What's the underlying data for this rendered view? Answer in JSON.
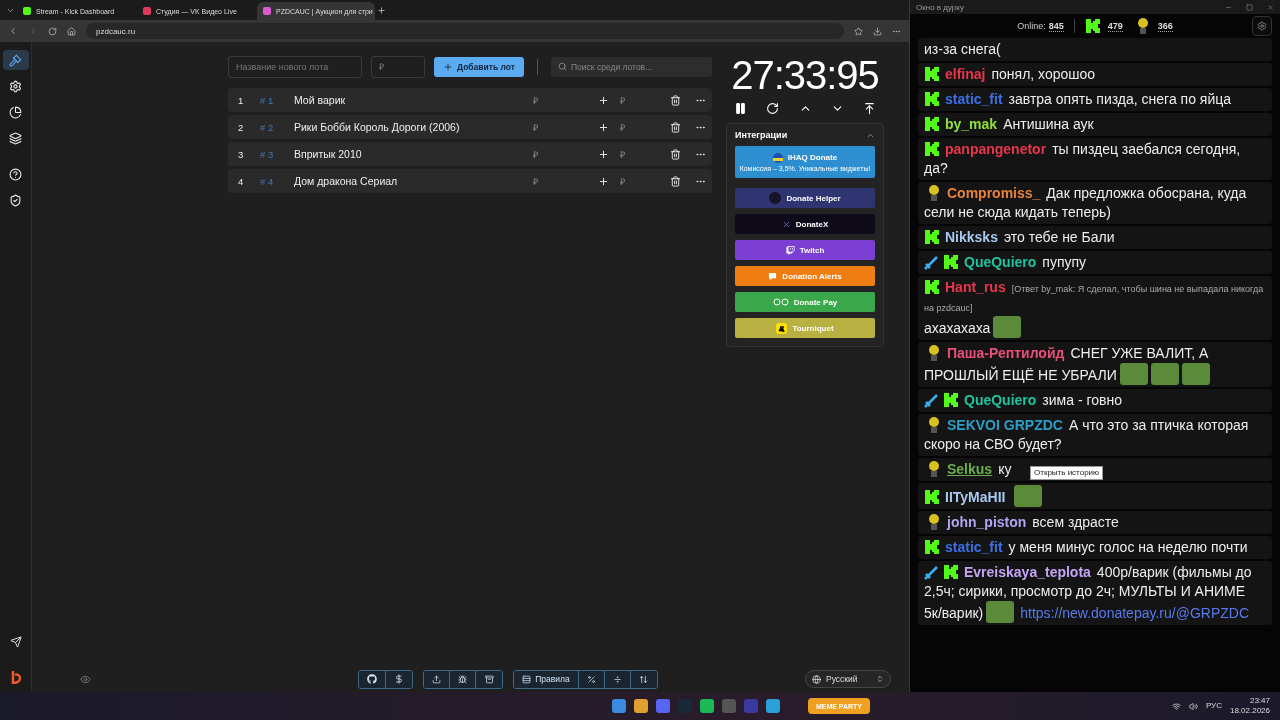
{
  "browser": {
    "tabs": [
      {
        "title": "Stream - Kick Dashboard",
        "kind": "kick",
        "selected": false
      },
      {
        "title": "Студия — VK Видео Live",
        "kind": "vk",
        "selected": false
      },
      {
        "title": "PZDCAUC | Аукцион для стри",
        "kind": "auc",
        "selected": true
      }
    ],
    "address": "pzdcauc.ru"
  },
  "sidebar": {
    "items": [
      {
        "kind": "gavel",
        "selected": true
      },
      {
        "kind": "settings",
        "selected": false
      },
      {
        "kind": "chart",
        "selected": false
      },
      {
        "kind": "layers",
        "selected": false
      },
      {
        "kind": "help",
        "selected": false
      },
      {
        "kind": "shield",
        "selected": false
      }
    ]
  },
  "lot_form": {
    "name_placeholder": "Название нового лота",
    "amount_placeholder": "₽",
    "add_button": "Добавить лот",
    "search_placeholder": "Поиск среди лотов..."
  },
  "lots": [
    {
      "index": "1",
      "tag": "# 1",
      "name": "Мой варик",
      "amount": "₽",
      "add_amount": "₽"
    },
    {
      "index": "2",
      "tag": "# 2",
      "name": "Рики Бобби Король Дороги (2006)",
      "amount": "₽",
      "add_amount": "₽"
    },
    {
      "index": "3",
      "tag": "# 3",
      "name": "Впритык 2010",
      "amount": "₽",
      "add_amount": "₽"
    },
    {
      "index": "4",
      "tag": "# 4",
      "name": "Дом дракона Сериал",
      "amount": "₽",
      "add_amount": "₽"
    }
  ],
  "timer": {
    "time": "27:33:95"
  },
  "integrations": {
    "title": "Интеграции",
    "expanded": true,
    "items": [
      {
        "kind": "featured",
        "label": "IHAQ Donate",
        "subtitle": "Комиссия – 3,5%. Уникальные виджеты!",
        "color": "#2d8fcf"
      },
      {
        "kind": "plain",
        "label": "Donate Helper",
        "color": "#2f3570"
      },
      {
        "kind": "plain",
        "label": "DonateX",
        "color": "#0e0a18"
      },
      {
        "kind": "plain",
        "label": "Twitch",
        "color": "#7b3fd4"
      },
      {
        "kind": "plain",
        "label": "Donation Alerts",
        "color": "#f07d12"
      },
      {
        "kind": "plain",
        "label": "Donate Pay",
        "color": "#3aa84a"
      },
      {
        "kind": "plain",
        "label": "Tourniquet",
        "color": "#b8b040"
      }
    ]
  },
  "toolbar": {
    "rules_button": "Правила",
    "language": "Русский"
  },
  "chat": {
    "window_title": "Окно в дурку",
    "online_label": "Online:",
    "online": "845",
    "kick_count": "479",
    "coin_count": "366",
    "messages": [
      {
        "text": "из-за снега("
      },
      {
        "badges": [
          {
            "kind": "kick"
          }
        ],
        "user": "elfinaj",
        "color": "#e8364a",
        "text": "понял, хорошоо"
      },
      {
        "badges": [
          {
            "kind": "kick"
          }
        ],
        "user": "static_fit",
        "color": "#3b6fe6",
        "text": "завтра опять пизда, снега по яйца"
      },
      {
        "badges": [
          {
            "kind": "kick"
          }
        ],
        "user": "by_mak",
        "color": "#8fe23a",
        "text": "Антишина аук"
      },
      {
        "badges": [
          {
            "kind": "kick"
          }
        ],
        "user": "panpangenetor",
        "color": "#e8364a",
        "text": "ты пиздец заебался сегодня, да?"
      },
      {
        "badges": [
          {
            "kind": "coin"
          }
        ],
        "user": "Compromiss_",
        "color": "#e8843a",
        "text": "Дак предложка обосрана, куда сели не сюда кидать теперь)"
      },
      {
        "badges": [
          {
            "kind": "kick"
          }
        ],
        "user": "Nikksks",
        "color": "#a8c8f0",
        "text": "это тебе не Бали"
      },
      {
        "badges": [
          {
            "kind": "sword"
          },
          {
            "kind": "kick"
          }
        ],
        "user": "QueQuiero",
        "color": "#1fc4a0",
        "text": "пупупу"
      },
      {
        "badges": [
          {
            "kind": "kick"
          }
        ],
        "user": "Hant_rus",
        "color": "#e8364a",
        "reply": "[Ответ by_mak: Я сделал, чтобы шина не выпадала никогда на pzdcauc]",
        "text": "ахахахаха",
        "emotes": [
          {
            "kind": "image"
          }
        ]
      },
      {
        "badges": [
          {
            "kind": "coin"
          }
        ],
        "user": "Паша-Рептилойд",
        "color": "#e8507a",
        "text": "СНЕГ УЖЕ ВАЛИТ, А ПРОШЛЫЙ ЕЩЁ НЕ УБРАЛИ",
        "emotes": [
          {
            "kind": "image"
          },
          {
            "kind": "image"
          },
          {
            "kind": "image"
          }
        ]
      },
      {
        "badges": [
          {
            "kind": "sword"
          },
          {
            "kind": "kick"
          }
        ],
        "user": "QueQuiero",
        "color": "#1fc4a0",
        "text": "зима - говно"
      },
      {
        "badges": [
          {
            "kind": "coin"
          }
        ],
        "user": "SEKVOI GRPZDC",
        "color": "#2aa0c8",
        "text": "А что это за птичка которая скоро на СВО будет?"
      },
      {
        "badges": [
          {
            "kind": "coin"
          }
        ],
        "user": "Selkus",
        "color": "#6ab04c",
        "text": "ку",
        "tooltip": "Открыть историю"
      },
      {
        "badges": [
          {
            "kind": "kick"
          }
        ],
        "user": "IITyMaHII",
        "color": "#a8c8f0",
        "emotes": [
          {
            "kind": "image"
          }
        ]
      },
      {
        "badges": [
          {
            "kind": "coin"
          }
        ],
        "user": "john_piston",
        "color": "#b4a4f4",
        "text": "всем здрасте"
      },
      {
        "badges": [
          {
            "kind": "kick"
          }
        ],
        "user": "static_fit",
        "color": "#3b6fe6",
        "text": "у меня минус голос на неделю почти"
      },
      {
        "badges": [
          {
            "kind": "sword"
          },
          {
            "kind": "kick"
          }
        ],
        "user": "Evreiskaya_teplota",
        "color": "#c4a4f4",
        "text": "400р/варик (фильмы до 2,5ч; сирики, просмотр до 2ч; МУЛЬТЫ И АНИМЕ 5к/варик)",
        "emotes": [
          {
            "kind": "image"
          }
        ],
        "link": "https://new.donatepay.ru/@GRPZDC"
      }
    ]
  },
  "taskbar": {
    "widget": "MEME PARTY",
    "language": "РУС",
    "time": "23:47",
    "date": "18.02.2026"
  }
}
